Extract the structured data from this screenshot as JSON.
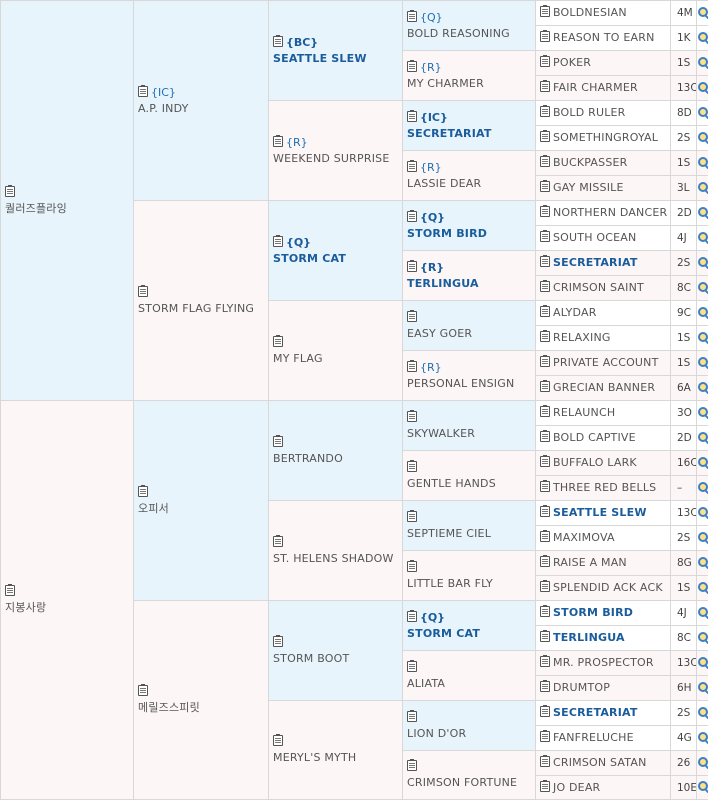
{
  "gen1": [
    {
      "name": "퀄러즈플라잉",
      "tag": "",
      "bold": false
    },
    {
      "name": "지봉사랑",
      "tag": "",
      "bold": false
    }
  ],
  "gen2": [
    {
      "name": "A.P. INDY",
      "tag": "{IC}",
      "bold": false
    },
    {
      "name": "STORM FLAG FLYING",
      "tag": "",
      "bold": false
    },
    {
      "name": "오피서",
      "tag": "",
      "bold": false
    },
    {
      "name": "메릴즈스피릿",
      "tag": "",
      "bold": false
    }
  ],
  "gen3": [
    {
      "name": "SEATTLE SLEW",
      "tag": "{BC}",
      "bold": true
    },
    {
      "name": "WEEKEND SURPRISE",
      "tag": "{R}",
      "bold": false
    },
    {
      "name": "STORM CAT",
      "tag": "{Q}",
      "bold": true
    },
    {
      "name": "MY FLAG",
      "tag": "",
      "bold": false
    },
    {
      "name": "BERTRANDO",
      "tag": "",
      "bold": false
    },
    {
      "name": "ST. HELENS SHADOW",
      "tag": "",
      "bold": false
    },
    {
      "name": "STORM BOOT",
      "tag": "",
      "bold": false
    },
    {
      "name": "MERYL'S MYTH",
      "tag": "",
      "bold": false
    }
  ],
  "gen4": [
    {
      "name": "BOLD REASONING",
      "tag": "{Q}",
      "bold": false
    },
    {
      "name": "MY CHARMER",
      "tag": "{R}",
      "bold": false
    },
    {
      "name": "SECRETARIAT",
      "tag": "{IC}",
      "bold": true
    },
    {
      "name": "LASSIE DEAR",
      "tag": "{R}",
      "bold": false
    },
    {
      "name": "STORM BIRD",
      "tag": "{Q}",
      "bold": true
    },
    {
      "name": "TERLINGUA",
      "tag": "{R}",
      "bold": true
    },
    {
      "name": "EASY GOER",
      "tag": "",
      "bold": false
    },
    {
      "name": "PERSONAL ENSIGN",
      "tag": "{R}",
      "bold": false
    },
    {
      "name": "SKYWALKER",
      "tag": "",
      "bold": false
    },
    {
      "name": "GENTLE HANDS",
      "tag": "",
      "bold": false
    },
    {
      "name": "SEPTIEME CIEL",
      "tag": "",
      "bold": false
    },
    {
      "name": "LITTLE BAR FLY",
      "tag": "",
      "bold": false
    },
    {
      "name": "STORM CAT",
      "tag": "{Q}",
      "bold": true
    },
    {
      "name": "ALIATA",
      "tag": "",
      "bold": false
    },
    {
      "name": "LION D'OR",
      "tag": "",
      "bold": false
    },
    {
      "name": "CRIMSON FORTUNE",
      "tag": "",
      "bold": false
    }
  ],
  "gen5": [
    {
      "name": "BOLDNESIAN",
      "code": "4M",
      "bold": false
    },
    {
      "name": "REASON TO EARN",
      "code": "1K",
      "bold": false
    },
    {
      "name": "POKER",
      "code": "1S",
      "bold": false
    },
    {
      "name": "FAIR CHARMER",
      "code": "13C",
      "bold": false
    },
    {
      "name": "BOLD RULER",
      "code": "8D",
      "bold": false
    },
    {
      "name": "SOMETHINGROYAL",
      "code": "2S",
      "bold": false
    },
    {
      "name": "BUCKPASSER",
      "code": "1S",
      "bold": false
    },
    {
      "name": "GAY MISSILE",
      "code": "3L",
      "bold": false
    },
    {
      "name": "NORTHERN DANCER",
      "code": "2D",
      "bold": false
    },
    {
      "name": "SOUTH OCEAN",
      "code": "4J",
      "bold": false
    },
    {
      "name": "SECRETARIAT",
      "code": "2S",
      "bold": true
    },
    {
      "name": "CRIMSON SAINT",
      "code": "8C",
      "bold": false
    },
    {
      "name": "ALYDAR",
      "code": "9C",
      "bold": false
    },
    {
      "name": "RELAXING",
      "code": "1S",
      "bold": false
    },
    {
      "name": "PRIVATE ACCOUNT",
      "code": "1S",
      "bold": false
    },
    {
      "name": "GRECIAN BANNER",
      "code": "6A",
      "bold": false
    },
    {
      "name": "RELAUNCH",
      "code": "3O",
      "bold": false
    },
    {
      "name": "BOLD CAPTIVE",
      "code": "2D",
      "bold": false
    },
    {
      "name": "BUFFALO LARK",
      "code": "16C",
      "bold": false
    },
    {
      "name": "THREE RED BELLS",
      "code": "–",
      "bold": false
    },
    {
      "name": "SEATTLE SLEW",
      "code": "13C",
      "bold": true
    },
    {
      "name": "MAXIMOVA",
      "code": "2S",
      "bold": false
    },
    {
      "name": "RAISE A MAN",
      "code": "8G",
      "bold": false
    },
    {
      "name": "SPLENDID ACK ACK",
      "code": "1S",
      "bold": false
    },
    {
      "name": "STORM BIRD",
      "code": "4J",
      "bold": true
    },
    {
      "name": "TERLINGUA",
      "code": "8C",
      "bold": true
    },
    {
      "name": "MR. PROSPECTOR",
      "code": "13C",
      "bold": false
    },
    {
      "name": "DRUMTOP",
      "code": "6H",
      "bold": false
    },
    {
      "name": "SECRETARIAT",
      "code": "2S",
      "bold": true
    },
    {
      "name": "FANFRELUCHE",
      "code": "4G",
      "bold": false
    },
    {
      "name": "CRIMSON SATAN",
      "code": "26",
      "bold": false
    },
    {
      "name": "JO DEAR",
      "code": "10E",
      "bold": false
    }
  ],
  "icons": {
    "clipboard": "clipboard-icon",
    "search": "magnifier-icon"
  },
  "colors": {
    "sire_bg": "#e8f4fb",
    "dam_bg": "#fdf6f6",
    "link_blue": "#1a5c9c"
  }
}
